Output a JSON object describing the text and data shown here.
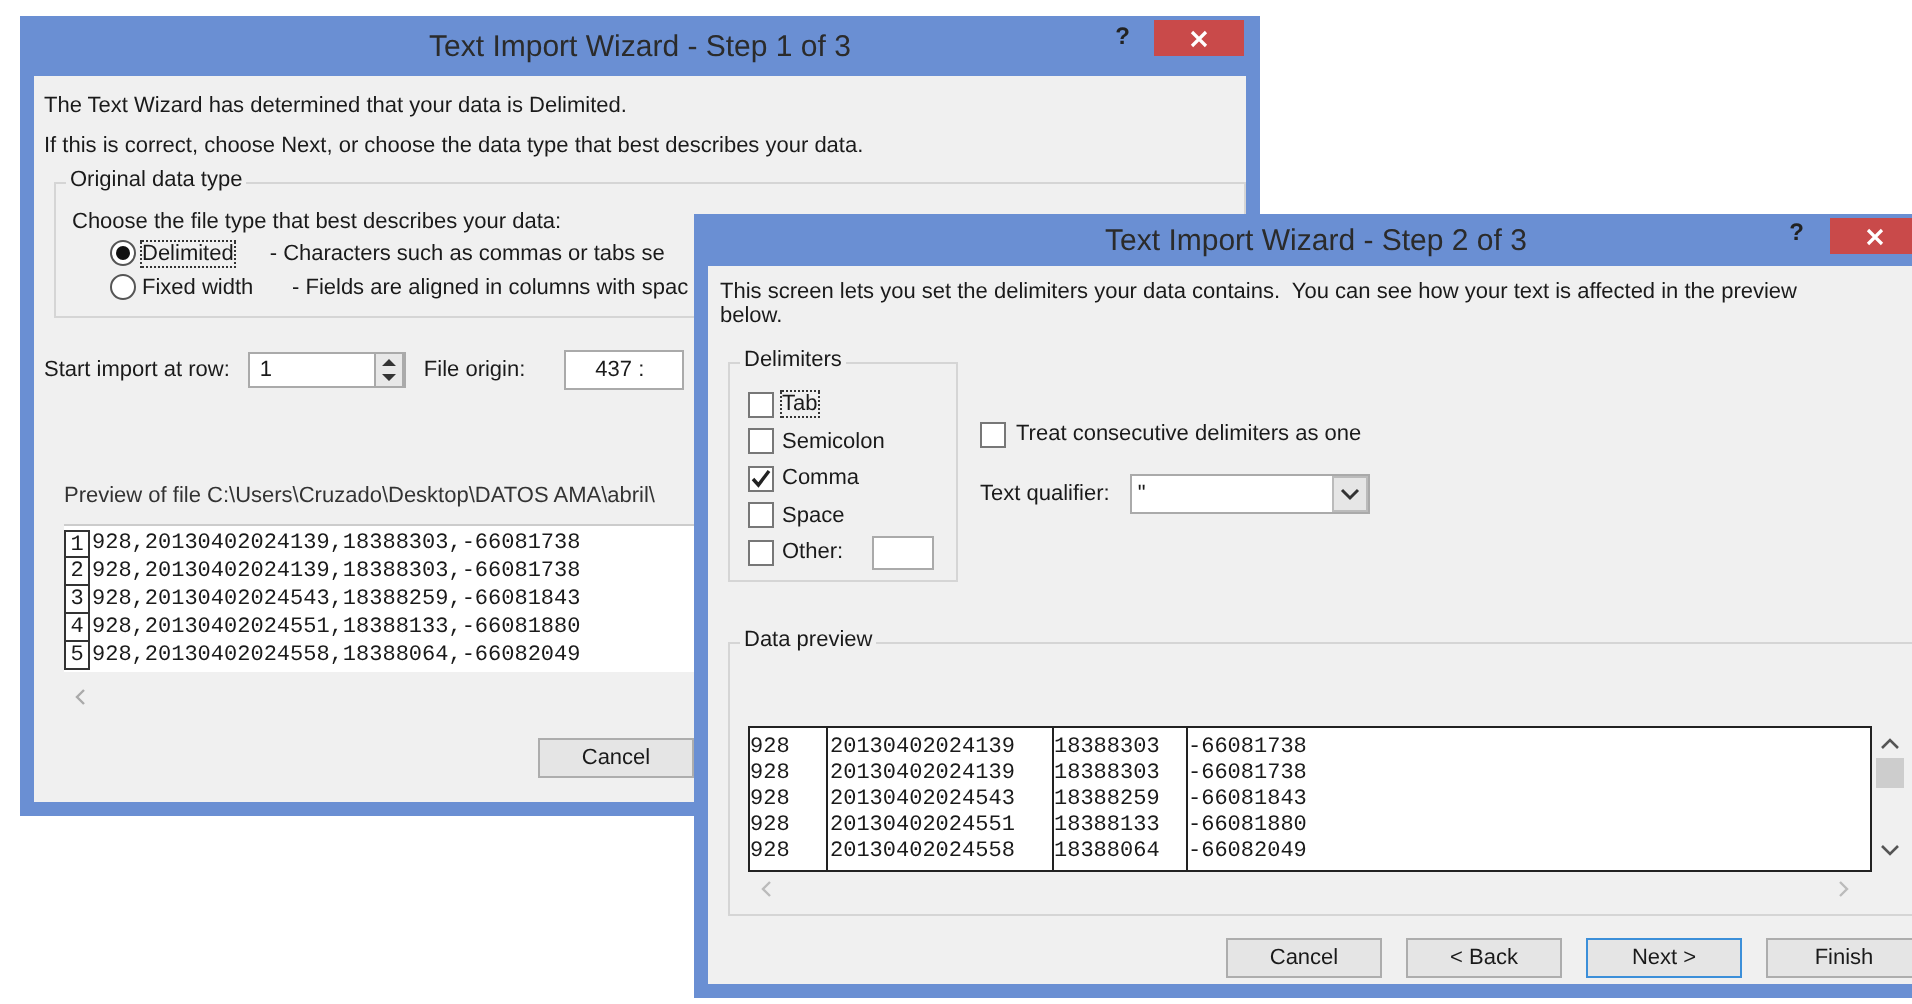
{
  "back_window": {
    "title": "Text Import Wizard - Step 1 of 3",
    "help": "?",
    "intro": [
      "The Text Wizard has determined that your data is Delimited.",
      "If this is correct, choose Next, or choose the data type that best describes your data."
    ],
    "data_type_group": {
      "label": "Original data type",
      "prompt": "Choose the file type that best describes your data:",
      "options": [
        {
          "label": "Delimited",
          "description": "- Characters such as commas or tabs se",
          "selected": true
        },
        {
          "label": "Fixed width",
          "description": "- Fields are aligned in columns with spac",
          "selected": false
        }
      ]
    },
    "start_row": {
      "label": "Start import at row:",
      "value": "1"
    },
    "file_origin": {
      "label": "File origin:",
      "value": "437 :"
    },
    "preview_label": "Preview of file C:\\Users\\Cruzado\\Desktop\\DATOS AMA\\abril\\",
    "preview_rows": [
      {
        "number": "1",
        "text": "928,20130402024139,18388303,-66081738"
      },
      {
        "number": "2",
        "text": "928,20130402024139,18388303,-66081738"
      },
      {
        "number": "3",
        "text": "928,20130402024543,18388259,-66081843"
      },
      {
        "number": "4",
        "text": "928,20130402024551,18388133,-66081880"
      },
      {
        "number": "5",
        "text": "928,20130402024558,18388064,-66082049"
      }
    ],
    "buttons": [
      "Cancel"
    ]
  },
  "front_window": {
    "title": "Text Import Wizard - Step 2 of 3",
    "help": "?",
    "intro": "This screen lets you set the delimiters your data contains.  You can see how your text is affected in the preview below.",
    "delimiters": {
      "label": "Delimiters",
      "options": [
        {
          "label": "Tab",
          "checked": false
        },
        {
          "label": "Semicolon",
          "checked": false
        },
        {
          "label": "Comma",
          "checked": true
        },
        {
          "label": "Space",
          "checked": false
        },
        {
          "label": "Other:",
          "checked": false
        }
      ]
    },
    "consecutive": {
      "label": "Treat consecutive delimiters as one",
      "checked": false
    },
    "text_qualifier": {
      "label": "Text qualifier:",
      "value": "\""
    },
    "data_preview": {
      "label": "Data preview",
      "rows": [
        [
          "928",
          "20130402024139",
          "18388303",
          "-66081738"
        ],
        [
          "928",
          "20130402024139",
          "18388303",
          "-66081738"
        ],
        [
          "928",
          "20130402024543",
          "18388259",
          "-66081843"
        ],
        [
          "928",
          "20130402024551",
          "18388133",
          "-66081880"
        ],
        [
          "928",
          "20130402024558",
          "18388064",
          "-66082049"
        ]
      ]
    },
    "buttons": [
      {
        "label": "Cancel",
        "selected": false
      },
      {
        "label": "< Back",
        "selected": false
      },
      {
        "label": "Next >",
        "selected": true
      },
      {
        "label": "Finish",
        "selected": false
      }
    ]
  }
}
